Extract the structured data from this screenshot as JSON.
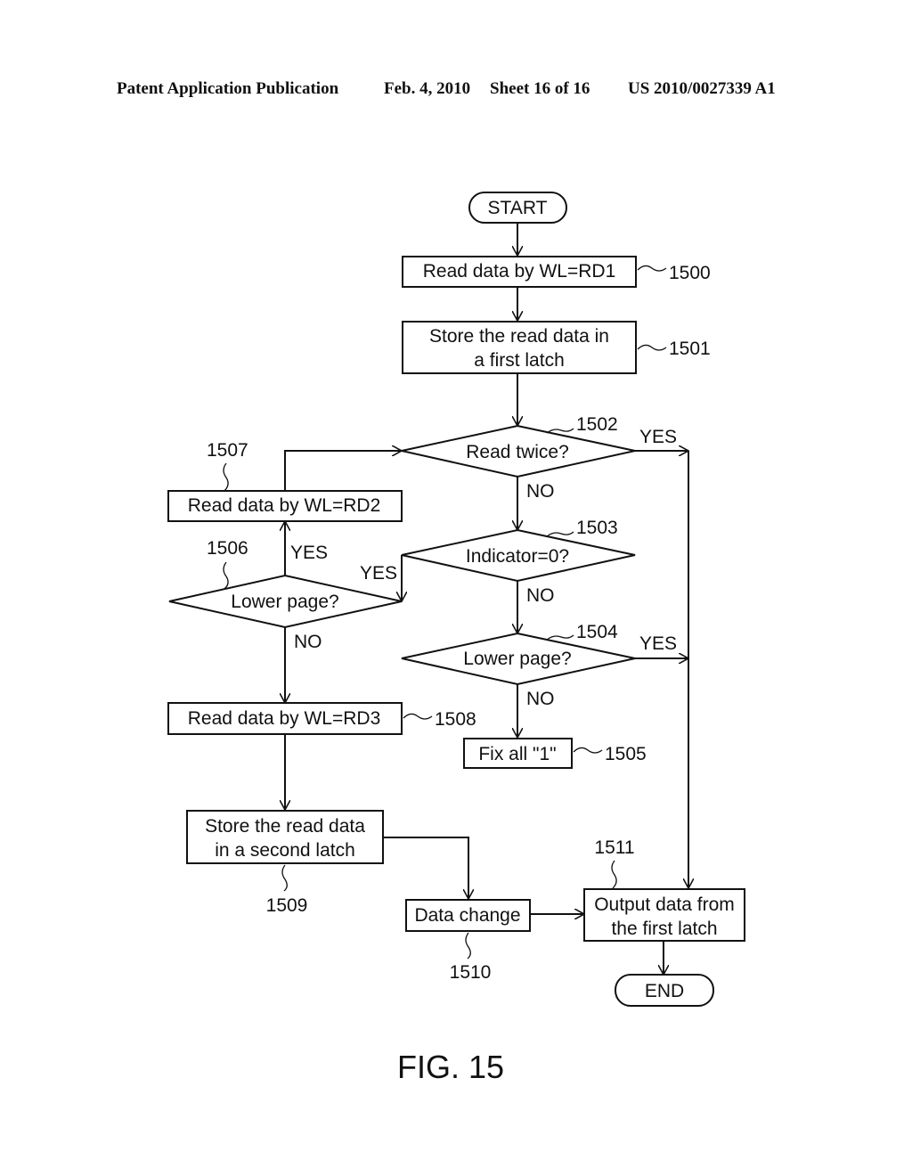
{
  "header": {
    "left": "Patent Application Publication",
    "date": "Feb. 4, 2010",
    "sheet": "Sheet 16 of 16",
    "number": "US 2010/0027339 A1"
  },
  "figure_label": "FIG. 15",
  "nodes": {
    "start": {
      "type": "terminal",
      "text": "START"
    },
    "n1500": {
      "type": "process",
      "ref": "1500",
      "lines": [
        "Read data by WL=RD1"
      ]
    },
    "n1501": {
      "type": "process",
      "ref": "1501",
      "lines": [
        "Store the read data in",
        "a first latch"
      ]
    },
    "n1502": {
      "type": "decision",
      "ref": "1502",
      "text": "Read twice?"
    },
    "n1503": {
      "type": "decision",
      "ref": "1503",
      "text": "Indicator=0?"
    },
    "n1504": {
      "type": "decision",
      "ref": "1504",
      "text": "Lower page?"
    },
    "n1505": {
      "type": "process",
      "ref": "1505",
      "lines": [
        "Fix all \"1\""
      ]
    },
    "n1506": {
      "type": "decision",
      "ref": "1506",
      "text": "Lower page?"
    },
    "n1507": {
      "type": "process",
      "ref": "1507",
      "lines": [
        "Read data by WL=RD2"
      ]
    },
    "n1508": {
      "type": "process",
      "ref": "1508",
      "lines": [
        "Read data by WL=RD3"
      ]
    },
    "n1509": {
      "type": "process",
      "ref": "1509",
      "lines": [
        "Store the read data",
        "in a second latch"
      ]
    },
    "n1510": {
      "type": "process",
      "ref": "1510",
      "lines": [
        "Data change"
      ]
    },
    "n1511": {
      "type": "process",
      "ref": "1511",
      "lines": [
        "Output data from",
        "the first latch"
      ]
    },
    "end": {
      "type": "terminal",
      "text": "END"
    }
  },
  "edge_labels": {
    "yes": "YES",
    "no": "NO"
  },
  "edges": [
    {
      "from": "start",
      "to": "n1500"
    },
    {
      "from": "n1500",
      "to": "n1501"
    },
    {
      "from": "n1501",
      "to": "n1502"
    },
    {
      "from": "n1502",
      "to": "n1511",
      "label": "YES"
    },
    {
      "from": "n1502",
      "to": "n1503",
      "label": "NO"
    },
    {
      "from": "n1503",
      "to": "n1506",
      "label": "YES"
    },
    {
      "from": "n1503",
      "to": "n1504",
      "label": "NO"
    },
    {
      "from": "n1504",
      "to": "n1511",
      "label": "YES"
    },
    {
      "from": "n1504",
      "to": "n1505",
      "label": "NO"
    },
    {
      "from": "n1506",
      "to": "n1507",
      "label": "YES"
    },
    {
      "from": "n1506",
      "to": "n1508",
      "label": "NO"
    },
    {
      "from": "n1507",
      "to": "n1502"
    },
    {
      "from": "n1508",
      "to": "n1509"
    },
    {
      "from": "n1509",
      "to": "n1510"
    },
    {
      "from": "n1510",
      "to": "n1511"
    },
    {
      "from": "n1511",
      "to": "end"
    }
  ]
}
